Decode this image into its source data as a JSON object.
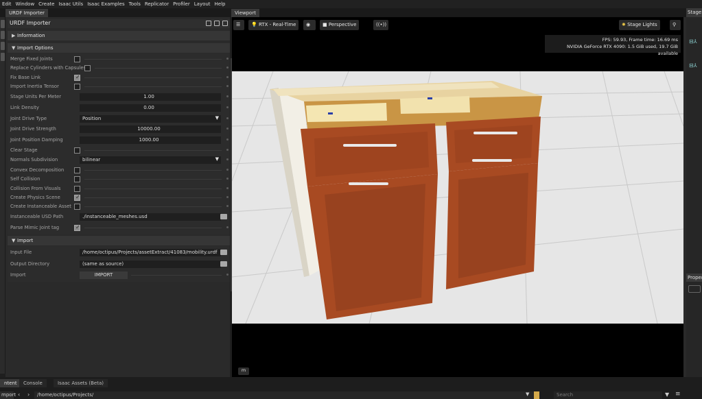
{
  "menu": [
    "Edit",
    "Window",
    "Create",
    "Isaac Utils",
    "Isaac Examples",
    "Tools",
    "Replicator",
    "Profiler",
    "Layout",
    "Help"
  ],
  "left_tab": "URDF Importer",
  "viewport_tab": "Viewport",
  "panel_title": "URDF Importer",
  "sections": {
    "information": "Information",
    "import_options": "Import Options",
    "import": "Import"
  },
  "options": {
    "merge_fixed_joints": {
      "label": "Merge Fixed Joints",
      "checked": false
    },
    "replace_cylinders": {
      "label": "Replace Cylinders with Capsules",
      "checked": false
    },
    "fix_base_link": {
      "label": "Fix Base Link",
      "checked": true
    },
    "import_inertia": {
      "label": "Import Inertia Tensor",
      "checked": false
    },
    "stage_units": {
      "label": "Stage Units Per Meter",
      "value": "1.00"
    },
    "link_density": {
      "label": "Link Density",
      "value": "0.00"
    },
    "joint_drive_type": {
      "label": "Joint Drive Type",
      "value": "Position"
    },
    "joint_drive_strength": {
      "label": "Joint Drive Strength",
      "value": "10000.00"
    },
    "joint_position_damping": {
      "label": "Joint Position Damping",
      "value": "1000.00"
    },
    "clear_stage": {
      "label": "Clear Stage",
      "checked": false
    },
    "normals_subdivision": {
      "label": "Normals Subdivision",
      "value": "bilinear"
    },
    "convex_decomposition": {
      "label": "Convex Decomposition",
      "checked": false
    },
    "self_collision": {
      "label": "Self Collision",
      "checked": false
    },
    "collision_from_visuals": {
      "label": "Collision From Visuals",
      "checked": false
    },
    "create_physics_scene": {
      "label": "Create Physics Scene",
      "checked": true
    },
    "create_instanceable": {
      "label": "Create Instanceable Asset",
      "checked": false
    },
    "instanceable_usd_path": {
      "label": "Instanceable USD Path",
      "value": "./instanceable_meshes.usd"
    },
    "parse_mimic": {
      "label": "Parse Mimic Joint tag",
      "checked": true
    }
  },
  "import": {
    "input_file": {
      "label": "Input File",
      "value": "/home/octipus/Projects/assetExtract/41083/mobility.urdf"
    },
    "output_dir": {
      "label": "Output Directory",
      "value": "(same as source)"
    },
    "import_row": {
      "label": "Import",
      "button": "IMPORT"
    }
  },
  "viewport": {
    "render_mode": "RTX - Real-Time",
    "camera": "Perspective",
    "stage_lights": "Stage Lights",
    "fps_line": "FPS: 59.93, Frame time: 16.69 ms",
    "gpu_line": "NVIDIA GeForce RTX 4090: 1.5 GiB used, 19.7 GiB available",
    "m_button": "m"
  },
  "right": {
    "stage_tab": "Stage",
    "properties_tab": "Proper"
  },
  "bottom": {
    "tabs": [
      "ntent",
      "Console",
      "Isaac Assets (Beta)"
    ],
    "import_btn": "mport",
    "path": "/home/octipus/Projects/",
    "search_placeholder": "Search"
  },
  "colors": {
    "cabinet": "#a84a22",
    "cabinet_dark": "#7c3519",
    "frame": "#e9e4d6",
    "floor": "#e3e3e3",
    "accent_checked": "#8d8d8d"
  }
}
